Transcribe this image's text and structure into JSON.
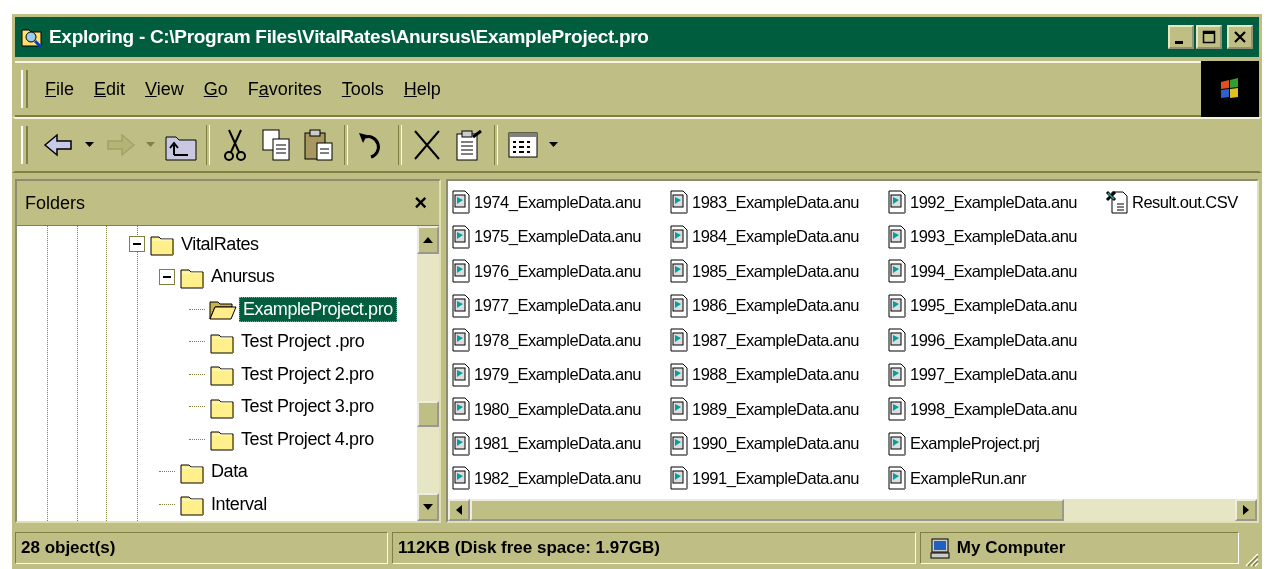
{
  "window": {
    "title": "Exploring - C:\\Program Files\\VitalRates\\Anursus\\ExampleProject.pro"
  },
  "menu": [
    {
      "key": "F",
      "post": "ile"
    },
    {
      "key": "E",
      "post": "dit"
    },
    {
      "key": "V",
      "post": "iew"
    },
    {
      "key": "G",
      "post": "o"
    },
    {
      "pre": "F",
      "key": "a",
      "post": "vorites"
    },
    {
      "key": "T",
      "post": "ools"
    },
    {
      "key": "H",
      "post": "elp"
    }
  ],
  "toolbar": [
    [
      {
        "kind": "back",
        "disabled": false
      },
      {
        "kind": "dropdown",
        "disabled": false
      },
      {
        "kind": "forward",
        "disabled": true
      },
      {
        "kind": "dropdown",
        "disabled": true
      },
      {
        "kind": "up",
        "disabled": false
      }
    ],
    [
      {
        "kind": "cut",
        "disabled": false
      },
      {
        "kind": "copy",
        "disabled": false
      },
      {
        "kind": "paste",
        "disabled": false
      }
    ],
    [
      {
        "kind": "undo",
        "disabled": false
      }
    ],
    [
      {
        "kind": "delete",
        "disabled": false
      },
      {
        "kind": "properties",
        "disabled": false
      }
    ],
    [
      {
        "kind": "views",
        "disabled": false
      },
      {
        "kind": "dropdown",
        "disabled": false
      }
    ]
  ],
  "folders_pane": {
    "title": "Folders",
    "close": "×"
  },
  "tree": [
    {
      "label": "VitalRates",
      "selected": false,
      "expanded": true,
      "children": [
        {
          "label": "Anursus",
          "selected": false,
          "expanded": true,
          "children": [
            {
              "label": "ExampleProject.pro",
              "selected": true
            },
            {
              "label": "Test Project .pro",
              "selected": false
            },
            {
              "label": "Test Project 2.pro",
              "selected": false
            },
            {
              "label": "Test Project 3.pro",
              "selected": false
            },
            {
              "label": "Test Project 4.pro",
              "selected": false
            }
          ]
        },
        {
          "label": "Data",
          "selected": false
        },
        {
          "label": "Interval",
          "selected": false
        }
      ]
    }
  ],
  "files": [
    {
      "name": "1974_ExampleData.anu",
      "kind": "data"
    },
    {
      "name": "1975_ExampleData.anu",
      "kind": "data"
    },
    {
      "name": "1976_ExampleData.anu",
      "kind": "data"
    },
    {
      "name": "1977_ExampleData.anu",
      "kind": "data"
    },
    {
      "name": "1978_ExampleData.anu",
      "kind": "data"
    },
    {
      "name": "1979_ExampleData.anu",
      "kind": "data"
    },
    {
      "name": "1980_ExampleData.anu",
      "kind": "data"
    },
    {
      "name": "1981_ExampleData.anu",
      "kind": "data"
    },
    {
      "name": "1982_ExampleData.anu",
      "kind": "data"
    },
    {
      "name": "1983_ExampleData.anu",
      "kind": "data"
    },
    {
      "name": "1984_ExampleData.anu",
      "kind": "data"
    },
    {
      "name": "1985_ExampleData.anu",
      "kind": "data"
    },
    {
      "name": "1986_ExampleData.anu",
      "kind": "data"
    },
    {
      "name": "1987_ExampleData.anu",
      "kind": "data"
    },
    {
      "name": "1988_ExampleData.anu",
      "kind": "data"
    },
    {
      "name": "1989_ExampleData.anu",
      "kind": "data"
    },
    {
      "name": "1990_ExampleData.anu",
      "kind": "data"
    },
    {
      "name": "1991_ExampleData.anu",
      "kind": "data"
    },
    {
      "name": "1992_ExampleData.anu",
      "kind": "data"
    },
    {
      "name": "1993_ExampleData.anu",
      "kind": "data"
    },
    {
      "name": "1994_ExampleData.anu",
      "kind": "data"
    },
    {
      "name": "1995_ExampleData.anu",
      "kind": "data"
    },
    {
      "name": "1996_ExampleData.anu",
      "kind": "data"
    },
    {
      "name": "1997_ExampleData.anu",
      "kind": "data"
    },
    {
      "name": "1998_ExampleData.anu",
      "kind": "data"
    },
    {
      "name": "ExampleProject.prj",
      "kind": "data"
    },
    {
      "name": "ExampleRun.anr",
      "kind": "data"
    },
    {
      "name": "Result.out.CSV",
      "kind": "csv"
    }
  ],
  "status_bar": {
    "objects": "28 object(s)",
    "size": "112KB (Disk free space: 1.97GB)",
    "zone": "My Computer"
  }
}
